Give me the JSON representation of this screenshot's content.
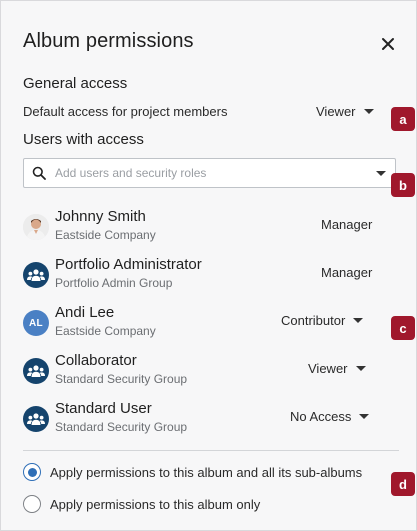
{
  "dialog": {
    "title": "Album permissions",
    "close_icon": "close-icon"
  },
  "general_access": {
    "heading": "General access",
    "default_label": "Default access for project members",
    "default_value": "Viewer"
  },
  "users_access": {
    "heading": "Users with access",
    "search_placeholder": "Add users and security roles"
  },
  "users": [
    {
      "name": "Johnny Smith",
      "org": "Eastside Company",
      "role": "Manager",
      "editable": false,
      "avatar": "photo"
    },
    {
      "name": "Portfolio Administrator",
      "org": "Portfolio Admin Group",
      "role": "Manager",
      "editable": false,
      "avatar": "group-icon"
    },
    {
      "name": "Andi Lee",
      "org": "Eastside Company",
      "role": "Contributor",
      "editable": true,
      "avatar": "initials",
      "initials": "AL"
    },
    {
      "name": "Collaborator",
      "org": "Standard Security Group",
      "role": "Viewer",
      "editable": true,
      "avatar": "group-icon"
    },
    {
      "name": "Standard User",
      "org": "Standard Security Group",
      "role": "No Access",
      "editable": true,
      "avatar": "group-icon"
    }
  ],
  "apply_options": [
    {
      "label": "Apply permissions to this album and all its sub-albums",
      "checked": true
    },
    {
      "label": "Apply permissions to this album only",
      "checked": false
    }
  ],
  "callouts": [
    "a",
    "b",
    "c",
    "d"
  ],
  "colors": {
    "callout": "#a0182c",
    "group_avatar": "#15446d",
    "initials_avatar": "#4a80c4",
    "radio_selected": "#2f6fb7"
  }
}
